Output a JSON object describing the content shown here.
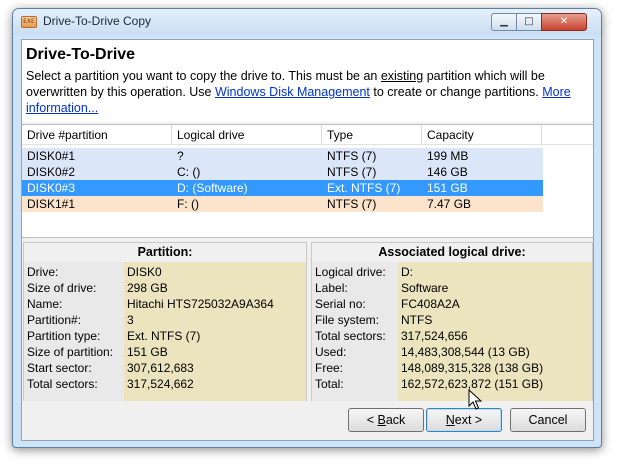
{
  "window": {
    "title": "Drive-To-Drive Copy",
    "icon_text": "EXE"
  },
  "controls": {
    "minimize": "▁",
    "maximize": "□",
    "close": "✕"
  },
  "header": {
    "title": "Drive-To-Drive",
    "desc_part1": "Select a partition you want to copy the drive to. This must be an ",
    "desc_existing": "existing",
    "desc_part2": " partition which will be overwritten by this operation. Use ",
    "link_disk_mgmt": "Windows Disk Management",
    "desc_part3": " to create or change partitions. ",
    "link_more_info": "More information..."
  },
  "list": {
    "columns": [
      "Drive #partition",
      "Logical drive",
      "Type",
      "Capacity"
    ],
    "rows": [
      {
        "drive": "DISK0#1",
        "logical": "?",
        "type": "NTFS (7)",
        "capacity": "199 MB",
        "bg": "#dbe7f8",
        "selected": false
      },
      {
        "drive": "DISK0#2",
        "logical": "C: ()",
        "type": "NTFS (7)",
        "capacity": "146 GB",
        "bg": "#dbe7f8",
        "selected": false
      },
      {
        "drive": "DISK0#3",
        "logical": "D: (Software)",
        "type": "Ext. NTFS (7)",
        "capacity": "151 GB",
        "bg": "#3399ff",
        "selected": true
      },
      {
        "drive": "DISK1#1",
        "logical": "F: ()",
        "type": "NTFS (7)",
        "capacity": "7.47 GB",
        "bg": "#fbe3cc",
        "selected": false
      }
    ]
  },
  "partition_panel": {
    "title": "Partition:",
    "items": [
      {
        "label": "Drive:",
        "value": "DISK0"
      },
      {
        "label": "Size of drive:",
        "value": "298 GB"
      },
      {
        "label": "Name:",
        "value": "Hitachi HTS725032A9A364"
      },
      {
        "label": "Partition#:",
        "value": "3"
      },
      {
        "label": "Partition type:",
        "value": "Ext. NTFS (7)"
      },
      {
        "label": "Size of partition:",
        "value": "151 GB"
      },
      {
        "label": "Start sector:",
        "value": "307,612,683"
      },
      {
        "label": "Total sectors:",
        "value": "317,524,662"
      }
    ]
  },
  "logical_panel": {
    "title": "Associated logical drive:",
    "items": [
      {
        "label": "Logical drive:",
        "value": "D:"
      },
      {
        "label": "Label:",
        "value": "Software"
      },
      {
        "label": "Serial no:",
        "value": "FC408A2A"
      },
      {
        "label": "File system:",
        "value": "NTFS"
      },
      {
        "label": "Total sectors:",
        "value": "317,524,656"
      },
      {
        "label": "Used:",
        "value": "14,483,308,544 (13 GB)"
      },
      {
        "label": "Free:",
        "value": "148,089,315,328 (138 GB)"
      },
      {
        "label": "Total:",
        "value": "162,572,623,872 (151 GB)"
      }
    ]
  },
  "buttons": {
    "back_prefix": "< ",
    "back_underline": "B",
    "back_rest": "ack",
    "next_underline": "N",
    "next_rest": "ext >",
    "cancel": "Cancel"
  },
  "colors": {
    "selection": "#3399ff",
    "row_blue": "#dbe7f8",
    "row_orange": "#fbe3cc",
    "value_bg": "#ece3bf",
    "link": "#0033cc"
  }
}
